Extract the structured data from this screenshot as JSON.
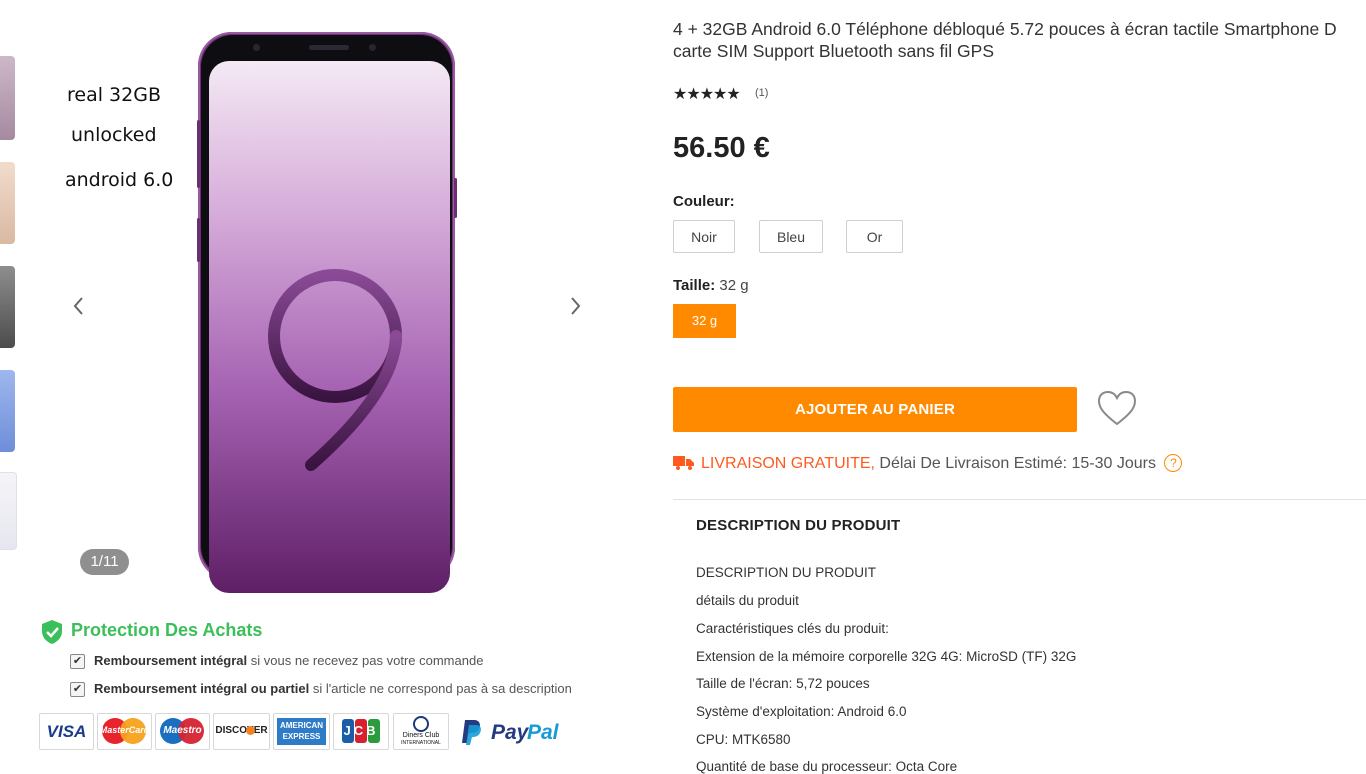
{
  "gallery": {
    "overlay_lines": [
      "real 32GB",
      "unlocked",
      "android 6.0"
    ],
    "counter": "1/11",
    "prev_icon": "chevron-left-icon",
    "next_icon": "chevron-right-icon"
  },
  "product": {
    "title_line1": "4 + 32GB Android 6.0 Téléphone débloqué 5.72 pouces à écran tactile Smartphone D",
    "title_line2": "carte SIM Support Bluetooth sans fil GPS",
    "stars": "★★★★★",
    "rating_count": "(1)",
    "price": "56.50 €"
  },
  "options": {
    "color_label": "Couleur:",
    "colors": [
      "Noir",
      "Bleu",
      "Or"
    ],
    "size_label": "Taille:",
    "size_selected": "32 g",
    "sizes": [
      "32 g"
    ],
    "accent": "#ff8a00"
  },
  "actions": {
    "add_to_cart": "AJOUTER AU PANIER",
    "wishlist_icon": "heart-icon"
  },
  "shipping": {
    "free": "LIVRAISON GRATUITE,",
    "estimate": "Délai De Livraison Estimé: 15-30 Jours",
    "help": "?"
  },
  "description": {
    "heading": "DESCRIPTION DU PRODUIT",
    "lines": [
      "DESCRIPTION DU PRODUIT",
      "détails du produit",
      "Caractéristiques clés du produit:",
      "Extension de la mémoire corporelle 32G 4G: MicroSD (TF) 32G",
      "Taille de l'écran: 5,72 pouces",
      "Système d'exploitation: Android 6.0",
      "CPU: MTK6580",
      "Quantité de base du processeur: Octa Core"
    ]
  },
  "protection": {
    "title": "Protection Des Achats",
    "items": [
      {
        "bold": "Remboursement intégral",
        "rest": " si vous ne recevez pas votre commande"
      },
      {
        "bold": "Remboursement intégral ou partiel",
        "rest": " si l'article ne correspond pas à sa description"
      }
    ],
    "green": "#3bbf5a"
  },
  "payments": {
    "visa": "VISA",
    "mastercard": "MasterCard",
    "maestro": "Maestro",
    "discover": "DISCOVER",
    "amex_1": "AMERICAN",
    "amex_2": "EXPRESS",
    "jcb": "JCB",
    "diners_1": "Diners Club",
    "diners_2": "INTERNATIONAL",
    "paypal_1": "Pay",
    "paypal_2": "Pal"
  }
}
